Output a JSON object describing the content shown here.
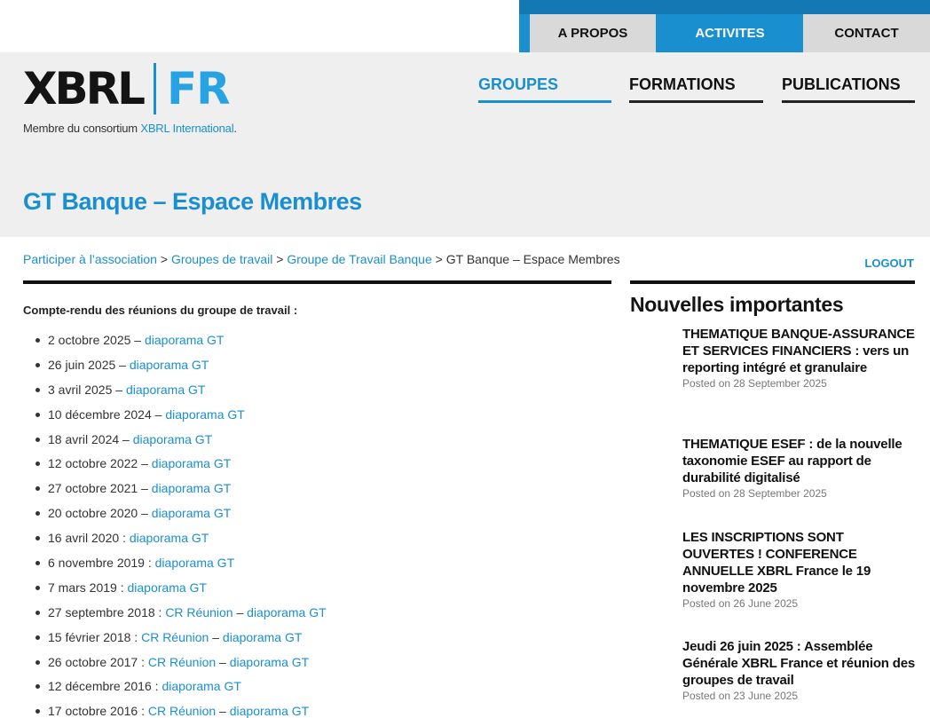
{
  "top_tabs": {
    "apropos": "A PROPOS",
    "activites": "ACTIVITES",
    "contact": "CONTACT"
  },
  "logo": {
    "left": "XBRL",
    "right": "FR"
  },
  "member": {
    "prefix": "Membre du consortium ",
    "link": "XBRL International",
    "suffix": "."
  },
  "nav": {
    "groupes": "GROUPES",
    "formations": "FORMATIONS",
    "publications": "PUBLICATIONS"
  },
  "page_title": "GT Banque – Espace Membres",
  "breadcrumb": {
    "items": [
      "Participer à l’association",
      "Groupes de travail",
      "Groupe de Travail Banque"
    ],
    "separator": " > ",
    "current": "GT Banque – Espace Membres"
  },
  "logout": "LOGOUT",
  "intro": "Compte-rendu des réunions du groupe de travail :",
  "reunions": [
    {
      "date": "2 octobre 2025",
      "sep": " – ",
      "cr": "",
      "cr_sep": "",
      "link": "diaporama GT"
    },
    {
      "date": "26 juin 2025",
      "sep": " – ",
      "cr": "",
      "cr_sep": "",
      "link": "diaporama GT"
    },
    {
      "date": "3 avril 2025",
      "sep": " – ",
      "cr": "",
      "cr_sep": "",
      "link": "diaporama GT"
    },
    {
      "date": "10 décembre 2024",
      "sep": " – ",
      "cr": "",
      "cr_sep": "",
      "link": "diaporama GT"
    },
    {
      "date": "18 avril 2024",
      "sep": " – ",
      "cr": "",
      "cr_sep": "",
      "link": "diaporama GT"
    },
    {
      "date": "12 octobre 2022",
      "sep": " – ",
      "cr": "",
      "cr_sep": "",
      "link": "diaporama GT"
    },
    {
      "date": "27 octobre 2021",
      "sep": " – ",
      "cr": "",
      "cr_sep": "",
      "link": "diaporama GT"
    },
    {
      "date": "20 octobre 2020",
      "sep": " – ",
      "cr": "",
      "cr_sep": "",
      "link": "diaporama GT"
    },
    {
      "date": "16 avril 2020",
      "sep": " : ",
      "cr": "",
      "cr_sep": "",
      "link": "diaporama GT"
    },
    {
      "date": "6 novembre 2019",
      "sep": " : ",
      "cr": "",
      "cr_sep": "",
      "link": "diaporama GT"
    },
    {
      "date": "7 mars 2019",
      "sep": " : ",
      "cr": "",
      "cr_sep": "",
      "link": "diaporama GT"
    },
    {
      "date": "27 septembre 2018",
      "sep": " : ",
      "cr": "CR Réunion",
      "cr_sep": " – ",
      "link": "diaporama GT"
    },
    {
      "date": "15 février 2018",
      "sep": " : ",
      "cr": "CR Réunion",
      "cr_sep": " – ",
      "link": "diaporama GT"
    },
    {
      "date": "26 octobre 2017",
      "sep": " : ",
      "cr": "CR Réunion",
      "cr_sep": " – ",
      "link": "diaporama GT"
    },
    {
      "date": "12 décembre 2016",
      "sep": " : ",
      "cr": "",
      "cr_sep": "",
      "link": "diaporama GT"
    },
    {
      "date": "17 octobre 2016",
      "sep": " : ",
      "cr": "CR Réunion",
      "cr_sep": " – ",
      "link": "diaporama GT"
    }
  ],
  "sidebar": {
    "title": "Nouvelles importantes",
    "news": [
      {
        "title": "THEMATIQUE BANQUE-ASSURANCE ET SERVICES FINANCIERS : vers un reporting intégré et granulaire",
        "date": "Posted on 28 September 2025"
      },
      {
        "title": "THEMATIQUE ESEF : de la nouvelle taxonomie ESEF au rapport de durabilité digitalisé",
        "date": "Posted on 28 September 2025"
      },
      {
        "title": "LES INSCRIPTIONS SONT OUVERTES ! CONFERENCE ANNUELLE XBRL France le 19 novembre 2025",
        "date": "Posted on 26 June 2025"
      },
      {
        "title": "Jeudi 26 juin 2025 : Assemblée Générale XBRL France et réunion des groupes de travail",
        "date": "Posted on 23 June 2025"
      }
    ]
  },
  "colors": {
    "accent": "#1a8fd0",
    "header_bg": "#efefef",
    "tab_grey": "#d9d9d9"
  }
}
